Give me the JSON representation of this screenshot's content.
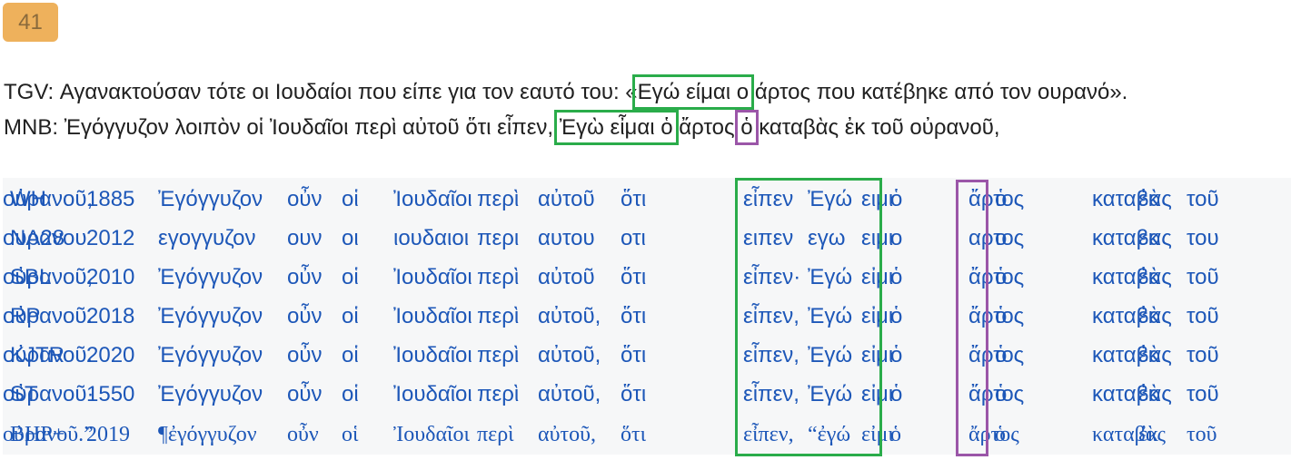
{
  "verse_number": "41",
  "translations": {
    "tgv": {
      "before": "TGV: Αγανακτούσαν τότε οι Ιουδαίοι που είπε για τον εαυτό του: «",
      "highlight": "Εγώ είμαι ο",
      "after": " άρτος που κατέβηκε από τον ουρανό»."
    },
    "mnb": {
      "before": "MNB: Ἐγόγγυζον λοιπὸν οἱ Ἰουδαῖοι περὶ αὐτοῦ ὅτι εἶπεν, ",
      "highlight": "Ἐγὼ εἶμαι ὁ",
      "middle": " ἄρτος ",
      "highlight2": "ὁ",
      "after": " καταβὰς ἐκ τοῦ οὐρανοῦ,"
    }
  },
  "colors": {
    "badge": "#eeb15c",
    "link": "#1d57b8",
    "green": "#2aac4a",
    "purple": "#9b56a8",
    "panel": "#f6f7f8"
  },
  "editions": [
    {
      "id": "WH",
      "year": "1885",
      "words": [
        "Ἐγόγγυζον",
        "οὖν",
        "οἱ",
        "Ἰουδαῖοι",
        "περὶ",
        "αὐτοῦ",
        "ὅτι",
        "εἶπεν",
        "Ἐγώ",
        "ειμι",
        "ὁ",
        "ἄρτος",
        "ὁ",
        "καταβὰς",
        "ἐκ",
        "τοῦ",
        "οὐρανοῦ,"
      ]
    },
    {
      "id": "NA28",
      "year": "2012",
      "words": [
        "εγογγυζον",
        "ουν",
        "οι",
        "ιουδαιοι",
        "περι",
        "αυτου",
        "οτι",
        "ειπεν",
        "εγω",
        "ειμι",
        "ο",
        "αρτος",
        "ο",
        "καταβας",
        "εκ",
        "του",
        "ουρανου"
      ]
    },
    {
      "id": "SBL",
      "year": "2010",
      "words": [
        "Ἐγόγγυζον",
        "οὖν",
        "οἱ",
        "Ἰουδαῖοι",
        "περὶ",
        "αὐτοῦ",
        "ὅτι",
        "εἶπεν·",
        "Ἐγώ",
        "εἰμι",
        "ὁ",
        "ἄρτος",
        "ὁ",
        "καταβὰς",
        "ἐκ",
        "τοῦ",
        "οὐρανοῦ,"
      ]
    },
    {
      "id": "RP",
      "year": "2018",
      "words": [
        "Ἐγόγγυζον",
        "οὖν",
        "οἱ",
        "Ἰουδαῖοι",
        "περὶ",
        "αὐτοῦ,",
        "ὅτι",
        "εἶπεν,",
        "Ἐγώ",
        "εἰμι",
        "ὁ",
        "ἄρτος",
        "ὁ",
        "καταβὰς",
        "ἐκ",
        "τοῦ",
        "οὐρανοῦ."
      ]
    },
    {
      "id": "KJTR",
      "year": "2020",
      "words": [
        "Ἐγόγγυζον",
        "οὖν",
        "οἱ",
        "Ἰουδαῖοι",
        "περὶ",
        "αὐτοῦ,",
        "ὅτι",
        "εἶπεν,",
        "Ἐγώ",
        "εἰμι",
        "ὁ",
        "ἄρτος",
        "ὁ",
        "καταβὰς",
        "ἐκ",
        "τοῦ",
        "οὐρανοῦ."
      ]
    },
    {
      "id": "ST",
      "year": "1550",
      "words": [
        "Ἐγόγγυζον",
        "οὖν",
        "οἱ",
        "Ἰουδαῖοι",
        "περὶ",
        "αὐτοῦ,",
        "ὅτι",
        "εἶπεν,",
        "Ἐγώ",
        "εἰμι",
        "ὁ",
        "ἄρτος",
        "ὁ",
        "καταβὰς",
        "ἐκ",
        "τοῦ",
        "οὐρανοῦ·"
      ]
    },
    {
      "id": "BHP+",
      "year": "2019",
      "words": [
        "¶ἐγόγγυζον",
        "οὖν",
        "οἱ",
        "Ἰουδαῖοι",
        "περὶ",
        "αὐτοῦ,",
        "ὅτι",
        "εἶπεν,",
        "“ἐγώ",
        "εἰμι",
        "ὁ",
        "ἄρτος",
        "ὁ",
        "καταβὰς",
        "ἐκ",
        "τοῦ",
        "οὐρανοῦ.”"
      ]
    }
  ]
}
